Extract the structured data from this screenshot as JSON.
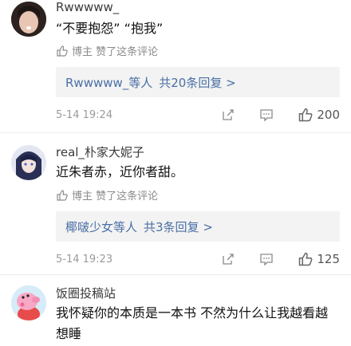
{
  "colors": {
    "link": "#4a6fa5",
    "muted": "#8a8a8a",
    "reply_bg": "#f3f3f3"
  },
  "comments": [
    {
      "username": "Rwwwww_",
      "text": "“不要抱怨” “抱我”",
      "liked_label": "博主 赞了这条评论",
      "reply_summary": {
        "names": "Rwwwww_等人",
        "count": "共20条回复 >"
      },
      "time": "5-14 19:24",
      "likes": "200",
      "avatar_icon": "user-avatar-girl-icon"
    },
    {
      "username": "real_朴家大妮子",
      "text": "近朱者赤，近你者甜。",
      "liked_label": "博主 赞了这条评论",
      "reply_summary": {
        "names": "椰啵少女等人",
        "count": "共3条回复 >"
      },
      "time": "5-14 19:23",
      "likes": "125",
      "avatar_icon": "user-avatar-anime-icon"
    },
    {
      "username": "饭圈投稿站",
      "text": "我怀疑你的本质是一本书 不然为什么让我越看越想睡",
      "avatar_icon": "user-avatar-peppa-icon"
    }
  ]
}
